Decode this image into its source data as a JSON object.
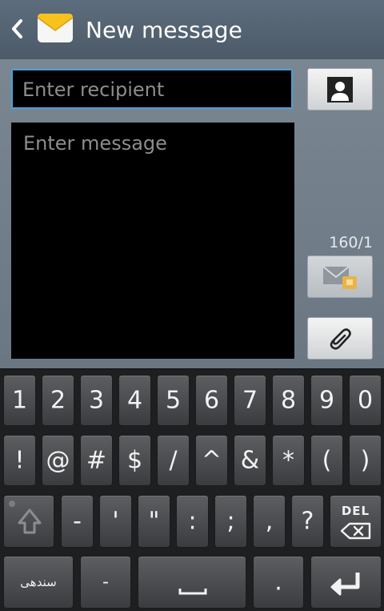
{
  "header": {
    "title": "New message",
    "back_icon": "back-chevron-icon",
    "app_icon": "envelope-icon"
  },
  "compose": {
    "recipient_placeholder": "Enter recipient",
    "message_placeholder": "Enter message",
    "char_counter": "160/1",
    "contacts_icon": "contact-person-icon",
    "send_icon": "send-message-icon",
    "attach_icon": "paperclip-icon"
  },
  "keyboard": {
    "row1": [
      "1",
      "2",
      "3",
      "4",
      "5",
      "6",
      "7",
      "8",
      "9",
      "0"
    ],
    "row2": [
      "!",
      "@",
      "#",
      "$",
      "/",
      "^",
      "&",
      "*",
      "(",
      ")"
    ],
    "row3": [
      "-",
      "'",
      "\"",
      ":",
      ";",
      ",",
      "?"
    ],
    "del_label": "DEL",
    "row4": {
      "lang": "سندهی",
      "dash": "-",
      "space_icon": "space-bar-icon",
      "dot": ".",
      "enter_icon": "enter-icon"
    },
    "shift_icon": "shift-arrow-icon",
    "backspace_icon": "backspace-icon"
  },
  "colors": {
    "accent": "#4aa0d8",
    "keyboard_bg": "#1e1f21",
    "key_face": "#4a4c4f",
    "header_bg": "#56646f"
  }
}
